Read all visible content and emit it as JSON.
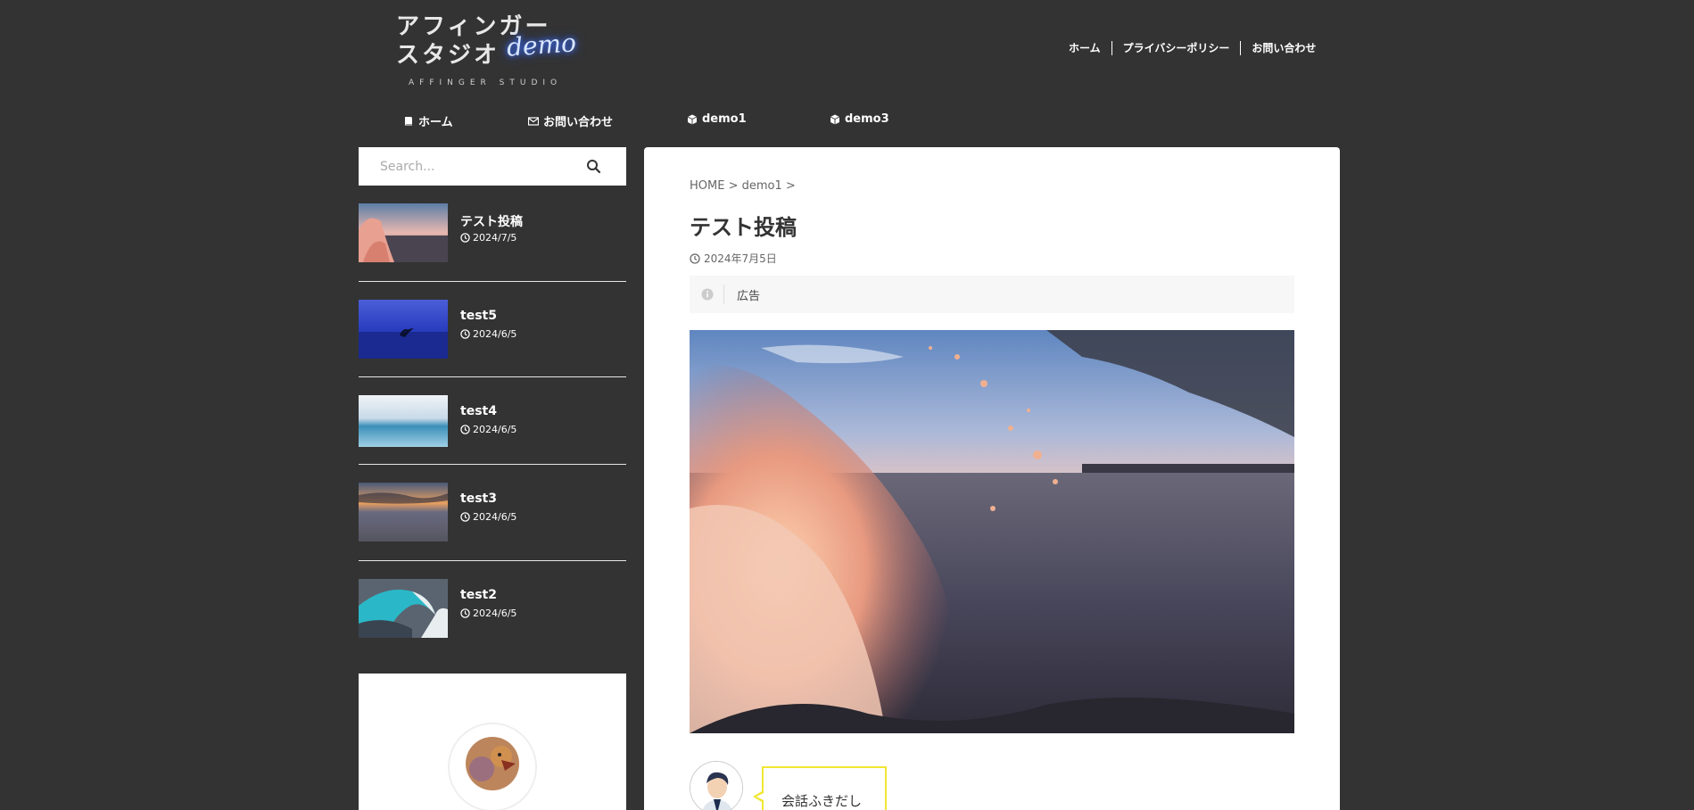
{
  "logo": {
    "line1": "アフィンガー",
    "line2": "スタジオ",
    "accent": "demo",
    "subtitle": "AFFINGER STUDIO"
  },
  "top_nav": [
    {
      "label": "ホーム"
    },
    {
      "label": "プライバシーポリシー"
    },
    {
      "label": "お問い合わせ"
    }
  ],
  "main_nav": [
    {
      "label": "ホーム",
      "icon": "book-icon"
    },
    {
      "label": "お問い合わせ",
      "icon": "mail-icon"
    },
    {
      "label": "demo1",
      "icon": "cube-icon"
    },
    {
      "label": "demo3",
      "icon": "cube-icon"
    }
  ],
  "search": {
    "placeholder": "Search..."
  },
  "posts": [
    {
      "title": "テスト投稿",
      "date": "2024/7/5"
    },
    {
      "title": "test5",
      "date": "2024/6/5"
    },
    {
      "title": "test4",
      "date": "2024/6/5"
    },
    {
      "title": "test3",
      "date": "2024/6/5"
    },
    {
      "title": "test2",
      "date": "2024/6/5"
    }
  ],
  "article": {
    "breadcrumb": [
      "HOME",
      "demo1"
    ],
    "title": "テスト投稿",
    "date": "2024年7月5日",
    "ad_label": "広告",
    "speech_text": "会話ふきだし"
  },
  "colors": {
    "background": "#333333",
    "card": "#ffffff",
    "bubble_border": "#f2e633",
    "text_dark": "#333333"
  }
}
